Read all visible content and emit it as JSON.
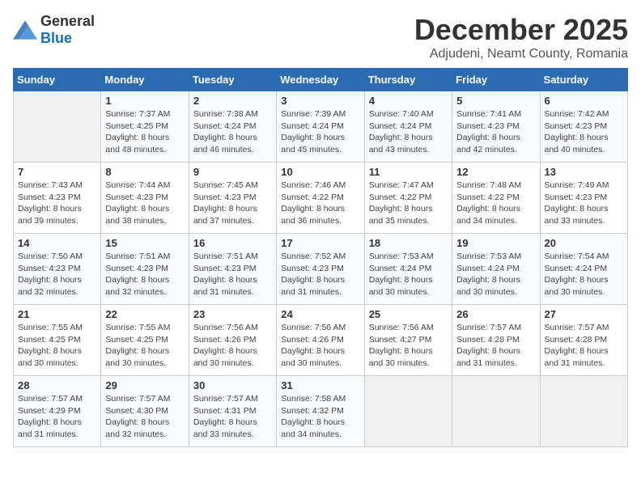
{
  "logo": {
    "general": "General",
    "blue": "Blue"
  },
  "header": {
    "month": "December 2025",
    "location": "Adjudeni, Neamt County, Romania"
  },
  "weekdays": [
    "Sunday",
    "Monday",
    "Tuesday",
    "Wednesday",
    "Thursday",
    "Friday",
    "Saturday"
  ],
  "weeks": [
    [
      {
        "day": "",
        "sunrise": "",
        "sunset": "",
        "daylight": ""
      },
      {
        "day": "1",
        "sunrise": "Sunrise: 7:37 AM",
        "sunset": "Sunset: 4:25 PM",
        "daylight": "Daylight: 8 hours and 48 minutes."
      },
      {
        "day": "2",
        "sunrise": "Sunrise: 7:38 AM",
        "sunset": "Sunset: 4:24 PM",
        "daylight": "Daylight: 8 hours and 46 minutes."
      },
      {
        "day": "3",
        "sunrise": "Sunrise: 7:39 AM",
        "sunset": "Sunset: 4:24 PM",
        "daylight": "Daylight: 8 hours and 45 minutes."
      },
      {
        "day": "4",
        "sunrise": "Sunrise: 7:40 AM",
        "sunset": "Sunset: 4:24 PM",
        "daylight": "Daylight: 8 hours and 43 minutes."
      },
      {
        "day": "5",
        "sunrise": "Sunrise: 7:41 AM",
        "sunset": "Sunset: 4:23 PM",
        "daylight": "Daylight: 8 hours and 42 minutes."
      },
      {
        "day": "6",
        "sunrise": "Sunrise: 7:42 AM",
        "sunset": "Sunset: 4:23 PM",
        "daylight": "Daylight: 8 hours and 40 minutes."
      }
    ],
    [
      {
        "day": "7",
        "sunrise": "Sunrise: 7:43 AM",
        "sunset": "Sunset: 4:23 PM",
        "daylight": "Daylight: 8 hours and 39 minutes."
      },
      {
        "day": "8",
        "sunrise": "Sunrise: 7:44 AM",
        "sunset": "Sunset: 4:23 PM",
        "daylight": "Daylight: 8 hours and 38 minutes."
      },
      {
        "day": "9",
        "sunrise": "Sunrise: 7:45 AM",
        "sunset": "Sunset: 4:23 PM",
        "daylight": "Daylight: 8 hours and 37 minutes."
      },
      {
        "day": "10",
        "sunrise": "Sunrise: 7:46 AM",
        "sunset": "Sunset: 4:22 PM",
        "daylight": "Daylight: 8 hours and 36 minutes."
      },
      {
        "day": "11",
        "sunrise": "Sunrise: 7:47 AM",
        "sunset": "Sunset: 4:22 PM",
        "daylight": "Daylight: 8 hours and 35 minutes."
      },
      {
        "day": "12",
        "sunrise": "Sunrise: 7:48 AM",
        "sunset": "Sunset: 4:22 PM",
        "daylight": "Daylight: 8 hours and 34 minutes."
      },
      {
        "day": "13",
        "sunrise": "Sunrise: 7:49 AM",
        "sunset": "Sunset: 4:23 PM",
        "daylight": "Daylight: 8 hours and 33 minutes."
      }
    ],
    [
      {
        "day": "14",
        "sunrise": "Sunrise: 7:50 AM",
        "sunset": "Sunset: 4:23 PM",
        "daylight": "Daylight: 8 hours and 32 minutes."
      },
      {
        "day": "15",
        "sunrise": "Sunrise: 7:51 AM",
        "sunset": "Sunset: 4:23 PM",
        "daylight": "Daylight: 8 hours and 32 minutes."
      },
      {
        "day": "16",
        "sunrise": "Sunrise: 7:51 AM",
        "sunset": "Sunset: 4:23 PM",
        "daylight": "Daylight: 8 hours and 31 minutes."
      },
      {
        "day": "17",
        "sunrise": "Sunrise: 7:52 AM",
        "sunset": "Sunset: 4:23 PM",
        "daylight": "Daylight: 8 hours and 31 minutes."
      },
      {
        "day": "18",
        "sunrise": "Sunrise: 7:53 AM",
        "sunset": "Sunset: 4:24 PM",
        "daylight": "Daylight: 8 hours and 30 minutes."
      },
      {
        "day": "19",
        "sunrise": "Sunrise: 7:53 AM",
        "sunset": "Sunset: 4:24 PM",
        "daylight": "Daylight: 8 hours and 30 minutes."
      },
      {
        "day": "20",
        "sunrise": "Sunrise: 7:54 AM",
        "sunset": "Sunset: 4:24 PM",
        "daylight": "Daylight: 8 hours and 30 minutes."
      }
    ],
    [
      {
        "day": "21",
        "sunrise": "Sunrise: 7:55 AM",
        "sunset": "Sunset: 4:25 PM",
        "daylight": "Daylight: 8 hours and 30 minutes."
      },
      {
        "day": "22",
        "sunrise": "Sunrise: 7:55 AM",
        "sunset": "Sunset: 4:25 PM",
        "daylight": "Daylight: 8 hours and 30 minutes."
      },
      {
        "day": "23",
        "sunrise": "Sunrise: 7:56 AM",
        "sunset": "Sunset: 4:26 PM",
        "daylight": "Daylight: 8 hours and 30 minutes."
      },
      {
        "day": "24",
        "sunrise": "Sunrise: 7:56 AM",
        "sunset": "Sunset: 4:26 PM",
        "daylight": "Daylight: 8 hours and 30 minutes."
      },
      {
        "day": "25",
        "sunrise": "Sunrise: 7:56 AM",
        "sunset": "Sunset: 4:27 PM",
        "daylight": "Daylight: 8 hours and 30 minutes."
      },
      {
        "day": "26",
        "sunrise": "Sunrise: 7:57 AM",
        "sunset": "Sunset: 4:28 PM",
        "daylight": "Daylight: 8 hours and 31 minutes."
      },
      {
        "day": "27",
        "sunrise": "Sunrise: 7:57 AM",
        "sunset": "Sunset: 4:28 PM",
        "daylight": "Daylight: 8 hours and 31 minutes."
      }
    ],
    [
      {
        "day": "28",
        "sunrise": "Sunrise: 7:57 AM",
        "sunset": "Sunset: 4:29 PM",
        "daylight": "Daylight: 8 hours and 31 minutes."
      },
      {
        "day": "29",
        "sunrise": "Sunrise: 7:57 AM",
        "sunset": "Sunset: 4:30 PM",
        "daylight": "Daylight: 8 hours and 32 minutes."
      },
      {
        "day": "30",
        "sunrise": "Sunrise: 7:57 AM",
        "sunset": "Sunset: 4:31 PM",
        "daylight": "Daylight: 8 hours and 33 minutes."
      },
      {
        "day": "31",
        "sunrise": "Sunrise: 7:58 AM",
        "sunset": "Sunset: 4:32 PM",
        "daylight": "Daylight: 8 hours and 34 minutes."
      },
      {
        "day": "",
        "sunrise": "",
        "sunset": "",
        "daylight": ""
      },
      {
        "day": "",
        "sunrise": "",
        "sunset": "",
        "daylight": ""
      },
      {
        "day": "",
        "sunrise": "",
        "sunset": "",
        "daylight": ""
      }
    ]
  ]
}
